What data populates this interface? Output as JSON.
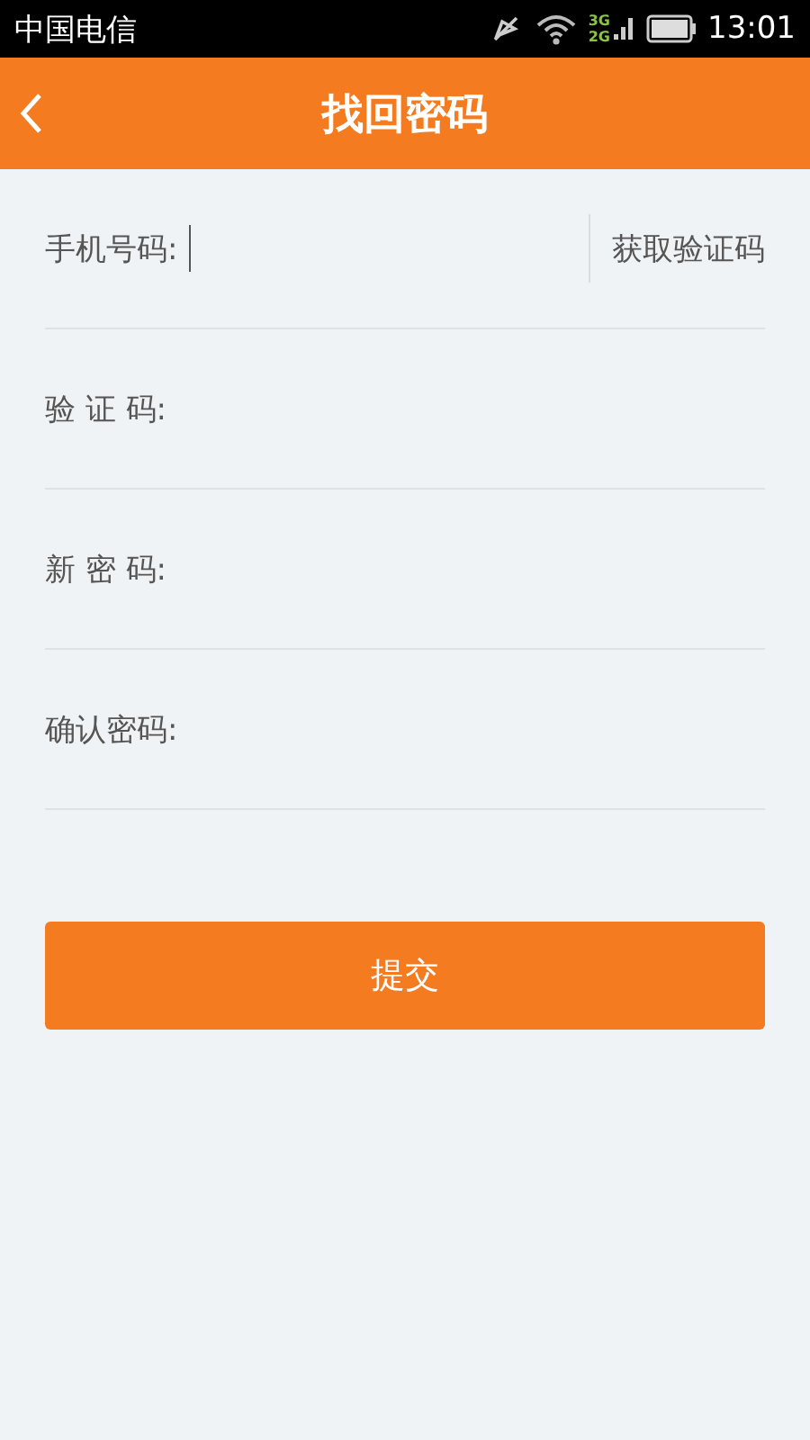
{
  "status_bar": {
    "carrier": "中国电信",
    "network_top": "3G",
    "network_bottom": "2G",
    "time": "13:01"
  },
  "header": {
    "title": "找回密码"
  },
  "fields": [
    {
      "label": "手机号码:",
      "focused": true,
      "action": "获取验证码"
    },
    {
      "label": "验 证 码:",
      "focused": false
    },
    {
      "label": "新 密 码:",
      "focused": false
    },
    {
      "label": "确认密码:",
      "focused": false
    }
  ],
  "submit": "提交"
}
